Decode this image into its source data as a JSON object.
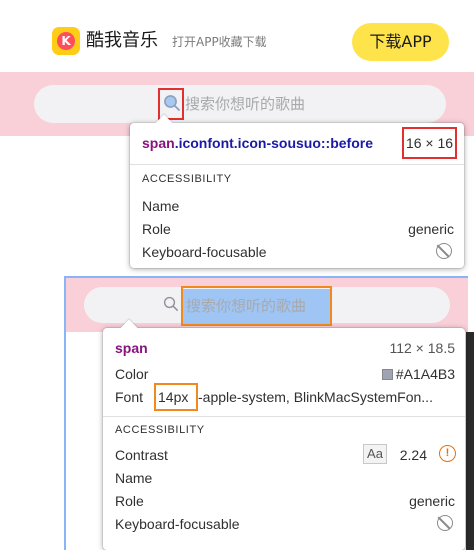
{
  "header": {
    "logo_letter": "K",
    "app_name": "酷我音乐",
    "promo": "打开APP收藏下载",
    "download_label": "下载APP",
    "accent_color": "#ffe34a"
  },
  "search": {
    "placeholder": "搜索你想听的歌曲"
  },
  "inspector_icon": {
    "selector_tag": "span",
    "selector_class": ".iconfont.icon-sousuo::before",
    "size": "16 × 16",
    "section": "ACCESSIBILITY",
    "rows": [
      {
        "label": "Name",
        "value": ""
      },
      {
        "label": "Role",
        "value": "generic"
      },
      {
        "label": "Keyboard-focusable",
        "value": ""
      }
    ]
  },
  "inspector_span": {
    "tag": "span",
    "dims": "112 × 18.5",
    "color_label": "Color",
    "color_value": "#A1A4B3",
    "font_label": "Font",
    "font_size": "14px",
    "font_family": "-apple-system, BlinkMacSystemFon...",
    "section": "ACCESSIBILITY",
    "contrast_label": "Contrast",
    "contrast_badge": "Aa",
    "contrast_value": "2.24",
    "rows": [
      {
        "label": "Name",
        "value": ""
      },
      {
        "label": "Role",
        "value": "generic"
      },
      {
        "label": "Keyboard-focusable",
        "value": ""
      }
    ]
  }
}
